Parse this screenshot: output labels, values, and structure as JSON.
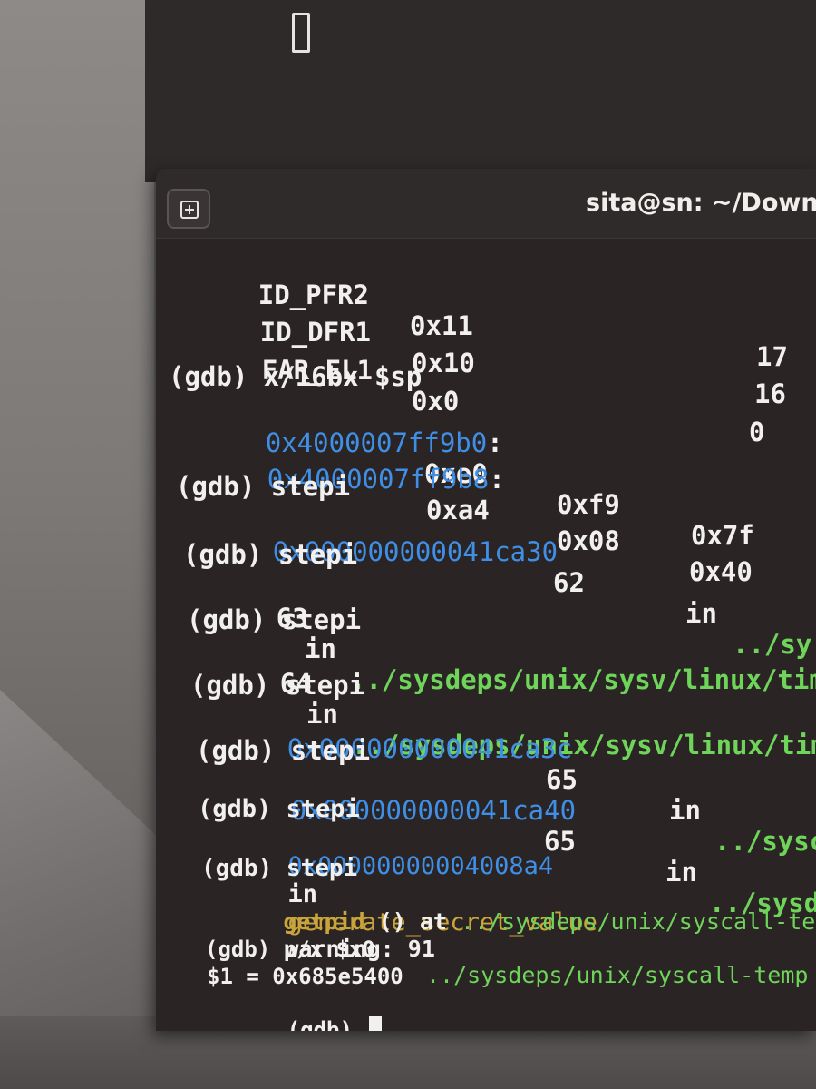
{
  "window": {
    "title": "sita@sn: ~/Downl"
  },
  "lines": {
    "r1": {
      "name": "ID_PFR2",
      "hex": "0x11",
      "dec": "17"
    },
    "r2": {
      "name": "ID_DFR1",
      "hex": "0x10",
      "dec": "16"
    },
    "r3": {
      "name": "FAR_EL1",
      "hex": "0x0",
      "dec": "0"
    },
    "cmd_x": "(gdb) x/16bx $sp",
    "mem1": {
      "addr": "0x4000007ff9b0",
      "b1": "0xe0",
      "b2": "0xf9",
      "b3": "0x7f"
    },
    "mem2": {
      "addr": "0x4000007ff9b8",
      "b1": "0xa4",
      "b2": "0x08",
      "b3": "0x40"
    },
    "stepi": "(gdb) stepi",
    "s1": {
      "addr": "0x000000000041ca30",
      "line": "62",
      "in": "in",
      "path": "../sy"
    },
    "s2": {
      "line": "63",
      "in": "in",
      "path": "../sysdeps/unix/sysv/linux/tim"
    },
    "s3": {
      "line": "64",
      "in": "in",
      "path": "../sysdeps/unix/sysv/linux/tim"
    },
    "s4": {
      "addr": "0x000000000041ca3c",
      "line": "65",
      "in": "in",
      "path": "../sysc"
    },
    "s5": {
      "addr": "0x000000000041ca40",
      "line": "65",
      "in": "in",
      "path": "../sysd"
    },
    "s6": {
      "addr": "0x00000000004008a4",
      "in": "in",
      "func": "generate_secret_value"
    },
    "getpid": {
      "func": "getpid",
      "rest": " () at ",
      "path": "../sysdeps/unix/syscall-templa"
    },
    "warning": {
      "text": "warning: 91",
      "path": "../sysdeps/unix/syscall-temp"
    },
    "cmd_p": "(gdb) p/x $x0",
    "result": "$1 = 0x685e5400",
    "prompt": "(gdb) "
  },
  "colors": {
    "address": "#3f8fe6",
    "path": "#6fd45a",
    "function": "#c8a43a",
    "text": "#f2f0ee",
    "background": "#2a2424"
  }
}
